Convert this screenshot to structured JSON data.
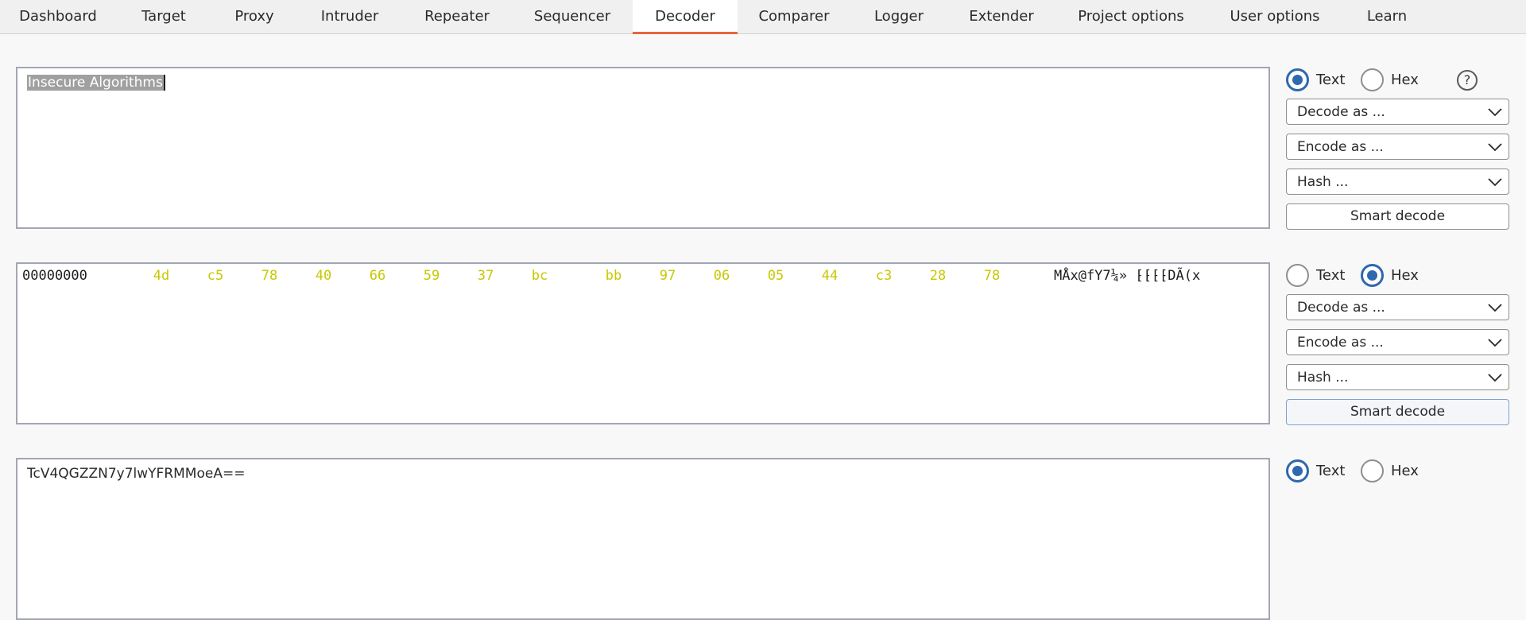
{
  "tabs": [
    "Dashboard",
    "Target",
    "Proxy",
    "Intruder",
    "Repeater",
    "Sequencer",
    "Decoder",
    "Comparer",
    "Logger",
    "Extender",
    "Project options",
    "User options",
    "Learn"
  ],
  "active_tab": "Decoder",
  "panel1": {
    "text": "Insecure Algorithms",
    "mode_text": "Text",
    "mode_hex": "Hex",
    "selected_mode": "Text",
    "help": "?",
    "decode": "Decode as ...",
    "encode": "Encode as ...",
    "hash": "Hash ...",
    "smart": "Smart decode"
  },
  "panel2": {
    "offset": "00000000",
    "bytes": [
      "4d",
      "c5",
      "78",
      "40",
      "66",
      "59",
      "37",
      "bc",
      "bb",
      "97",
      "06",
      "05",
      "44",
      "c3",
      "28",
      "78"
    ],
    "ascii": "MÅx@fY7¼» ⁅⁅⁅⁅DÃ(x",
    "mode_text": "Text",
    "mode_hex": "Hex",
    "selected_mode": "Hex",
    "decode": "Decode as ...",
    "encode": "Encode as ...",
    "hash": "Hash ...",
    "smart": "Smart decode"
  },
  "panel3": {
    "text": "TcV4QGZZN7y7lwYFRMMoeA==",
    "mode_text": "Text",
    "mode_hex": "Hex",
    "selected_mode": "Text"
  },
  "colors": {
    "accent_tab": "#e8663c",
    "radio_checked": "#2f68ad",
    "hex_bytes": "#c8c800"
  }
}
